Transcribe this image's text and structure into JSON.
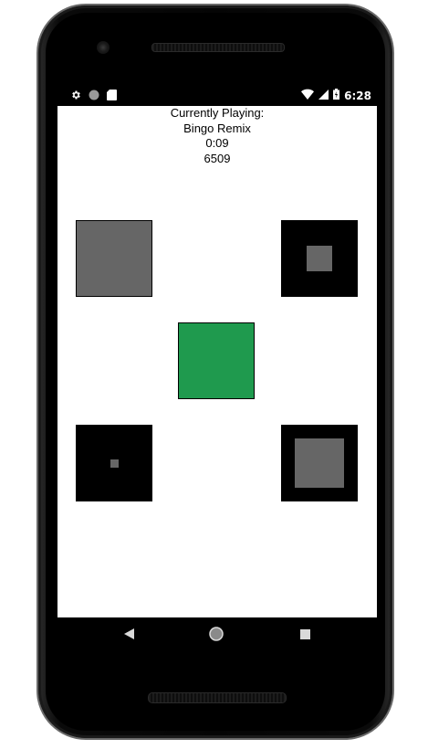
{
  "status_bar": {
    "left_icons": [
      "gear-icon",
      "circle-status-icon",
      "sd-card-icon"
    ],
    "right_icons": [
      "wifi-icon",
      "cell-signal-icon",
      "battery-icon"
    ],
    "time": "6:28"
  },
  "player": {
    "heading": "Currently Playing:",
    "track": "Bingo Remix",
    "elapsed": "0:09",
    "score": "6509"
  },
  "tiles": [
    {
      "id": "top-left",
      "style": "solid",
      "color": "#666666"
    },
    {
      "id": "top-right",
      "style": "ring",
      "outer_color": "#000000",
      "inner_color": "#666666",
      "inner_fraction": 0.33
    },
    {
      "id": "center",
      "style": "solid",
      "color": "#1f9a4e"
    },
    {
      "id": "bottom-left",
      "style": "ring",
      "outer_color": "#000000",
      "inner_color": "#666666",
      "inner_fraction": 0.11
    },
    {
      "id": "bottom-right",
      "style": "ring",
      "outer_color": "#000000",
      "inner_color": "#666666",
      "inner_fraction": 0.64
    }
  ],
  "nav": {
    "buttons": [
      "back-icon",
      "home-icon",
      "recents-icon"
    ]
  }
}
